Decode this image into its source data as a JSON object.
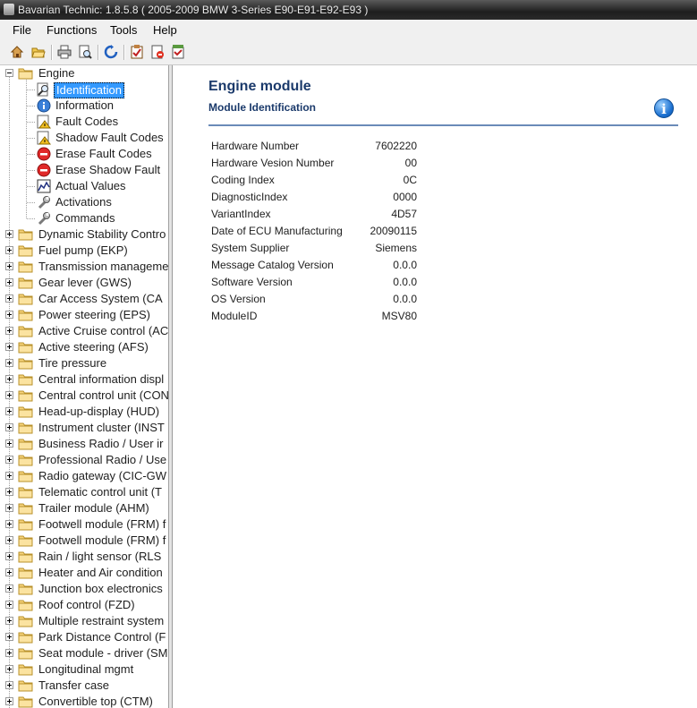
{
  "window": {
    "title": "Bavarian Technic: 1.8.5.8  ( 2005-2009 BMW 3-Series E90-E91-E92-E93 )"
  },
  "menu": [
    "File",
    "Functions",
    "Tools",
    "Help"
  ],
  "toolbar": [
    "home-icon",
    "open-folder-icon",
    "print-icon",
    "print-preview-icon",
    "refresh-icon",
    "checklist-icon",
    "report-icon",
    "log-icon"
  ],
  "tree": {
    "root": "Engine",
    "children": [
      "Identification",
      "Information",
      "Fault Codes",
      "Shadow Fault Codes",
      "Erase Fault Codes",
      "Erase Shadow Fault",
      "Actual Values",
      "Activations",
      "Commands"
    ],
    "child_icons": [
      "magnifier-doc-icon",
      "info-icon",
      "warning-doc-icon",
      "warning-doc-icon",
      "stop-icon",
      "stop-icon",
      "chart-icon",
      "wrench-icon",
      "wrench-icon"
    ],
    "selected": "Identification",
    "modules": [
      "Dynamic Stability Contro",
      "Fuel pump (EKP)",
      "Transmission manageme",
      "Gear lever (GWS)",
      "Car Access System (CA",
      "Power steering (EPS)",
      "Active Cruise control (AC",
      "Active steering (AFS)",
      "Tire pressure",
      "Central information displ",
      "Central control unit (CON",
      "Head-up-display (HUD)",
      "Instrument cluster (INST",
      "Business Radio / User ir",
      "Professional Radio / Use",
      "Radio gateway (CIC-GW",
      "Telematic control unit (T",
      "Trailer module (AHM)",
      "Footwell module (FRM) f",
      "Footwell module (FRM) f",
      "Rain / light sensor (RLS",
      "Heater and Air condition",
      "Junction box electronics",
      "Roof control (FZD)",
      "Multiple restraint system",
      "Park Distance Control (F",
      "Seat module - driver (SM",
      "Longitudinal mgmt",
      "Transfer case",
      "Convertible top (CTM)"
    ]
  },
  "content": {
    "title": "Engine module",
    "subtitle": "Module Identification",
    "rows": [
      {
        "key": "Hardware Number",
        "value": "7602220"
      },
      {
        "key": "Hardware Vesion Number",
        "value": "00"
      },
      {
        "key": "Coding Index",
        "value": "0C"
      },
      {
        "key": "DiagnosticIndex",
        "value": "0000"
      },
      {
        "key": "VariantIndex",
        "value": "4D57"
      },
      {
        "key": "Date of ECU Manufacturing",
        "value": "20090115"
      },
      {
        "key": "System Supplier",
        "value": "Siemens"
      },
      {
        "key": "Message Catalog Version",
        "value": "0.0.0"
      },
      {
        "key": "Software Version",
        "value": "0.0.0"
      },
      {
        "key": "OS Version",
        "value": "0.0.0"
      },
      {
        "key": "ModuleID",
        "value": "MSV80"
      }
    ]
  },
  "colors": {
    "heading": "#1b3a6b",
    "selection": "#3399ff",
    "rule": "#6a8bb8"
  }
}
